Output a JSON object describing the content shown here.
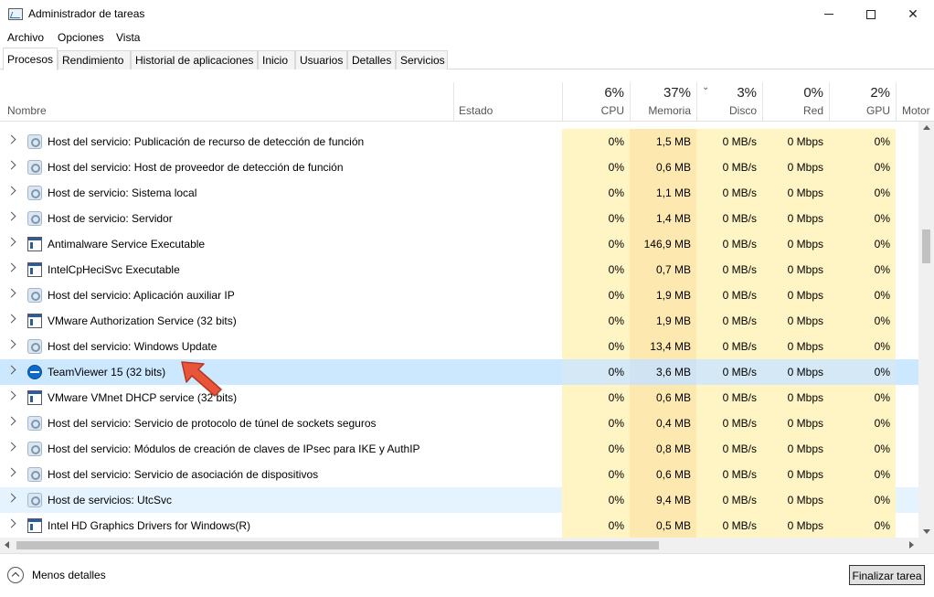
{
  "window": {
    "title": "Administrador de tareas",
    "controls": [
      "minimize",
      "maximize",
      "close"
    ]
  },
  "menu": [
    "Archivo",
    "Opciones",
    "Vista"
  ],
  "tabs": [
    {
      "label": "Procesos",
      "active": true
    },
    {
      "label": "Rendimiento",
      "active": false
    },
    {
      "label": "Historial de aplicaciones",
      "active": false
    },
    {
      "label": "Inicio",
      "active": false
    },
    {
      "label": "Usuarios",
      "active": false
    },
    {
      "label": "Detalles",
      "active": false
    },
    {
      "label": "Servicios",
      "active": false
    }
  ],
  "columns": {
    "name": "Nombre",
    "status": "Estado",
    "cpu": {
      "pct": "6%",
      "label": "CPU"
    },
    "memory": {
      "pct": "37%",
      "label": "Memoria"
    },
    "disk": {
      "pct": "3%",
      "label": "Disco"
    },
    "network": {
      "pct": "0%",
      "label": "Red"
    },
    "gpu": {
      "pct": "2%",
      "label": "GPU"
    },
    "engine": {
      "label": "Motor"
    }
  },
  "rows": [
    {
      "icon": "service-gear-icon",
      "name": "Host del servicio: Publicación de recurso de detección de función",
      "cpu": "0%",
      "mem": "1,5 MB",
      "disk": "0 MB/s",
      "net": "0 Mbps",
      "gpu": "0%"
    },
    {
      "icon": "service-gear-icon",
      "name": "Host del servicio: Host de proveedor de detección de función",
      "cpu": "0%",
      "mem": "0,6 MB",
      "disk": "0 MB/s",
      "net": "0 Mbps",
      "gpu": "0%"
    },
    {
      "icon": "service-gear-icon",
      "name": "Host de servicio: Sistema local",
      "cpu": "0%",
      "mem": "1,1 MB",
      "disk": "0 MB/s",
      "net": "0 Mbps",
      "gpu": "0%"
    },
    {
      "icon": "service-gear-icon",
      "name": "Host de servicio: Servidor",
      "cpu": "0%",
      "mem": "1,4 MB",
      "disk": "0 MB/s",
      "net": "0 Mbps",
      "gpu": "0%"
    },
    {
      "icon": "app-window-icon",
      "name": "Antimalware Service Executable",
      "cpu": "0%",
      "mem": "146,9 MB",
      "disk": "0 MB/s",
      "net": "0 Mbps",
      "gpu": "0%"
    },
    {
      "icon": "app-window-icon",
      "name": "IntelCpHeciSvc Executable",
      "cpu": "0%",
      "mem": "0,7 MB",
      "disk": "0 MB/s",
      "net": "0 Mbps",
      "gpu": "0%"
    },
    {
      "icon": "service-gear-icon",
      "name": "Host del servicio: Aplicación auxiliar IP",
      "cpu": "0%",
      "mem": "1,9 MB",
      "disk": "0 MB/s",
      "net": "0 Mbps",
      "gpu": "0%"
    },
    {
      "icon": "app-window-icon",
      "name": "VMware Authorization Service (32 bits)",
      "cpu": "0%",
      "mem": "1,9 MB",
      "disk": "0 MB/s",
      "net": "0 Mbps",
      "gpu": "0%"
    },
    {
      "icon": "service-gear-icon",
      "name": "Host del servicio: Windows Update",
      "cpu": "0%",
      "mem": "13,4 MB",
      "disk": "0 MB/s",
      "net": "0 Mbps",
      "gpu": "0%"
    },
    {
      "icon": "teamviewer-icon",
      "name": "TeamViewer 15 (32 bits)",
      "cpu": "0%",
      "mem": "3,6 MB",
      "disk": "0 MB/s",
      "net": "0 Mbps",
      "gpu": "0%",
      "state": "selected"
    },
    {
      "icon": "app-window-icon",
      "name": "VMware VMnet DHCP service (32 bits)",
      "cpu": "0%",
      "mem": "0,6 MB",
      "disk": "0 MB/s",
      "net": "0 Mbps",
      "gpu": "0%"
    },
    {
      "icon": "service-gear-icon",
      "name": "Host del servicio: Servicio de protocolo de túnel de sockets seguros",
      "cpu": "0%",
      "mem": "0,4 MB",
      "disk": "0 MB/s",
      "net": "0 Mbps",
      "gpu": "0%"
    },
    {
      "icon": "service-gear-icon",
      "name": "Host del servicio: Módulos de creación de claves de IPsec para IKE y AuthIP",
      "cpu": "0%",
      "mem": "0,8 MB",
      "disk": "0 MB/s",
      "net": "0 Mbps",
      "gpu": "0%"
    },
    {
      "icon": "service-gear-icon",
      "name": "Host del servicio: Servicio de asociación de dispositivos",
      "cpu": "0%",
      "mem": "0,6 MB",
      "disk": "0 MB/s",
      "net": "0 Mbps",
      "gpu": "0%"
    },
    {
      "icon": "service-gear-icon",
      "name": "Host de servicios: UtcSvc",
      "cpu": "0%",
      "mem": "9,4 MB",
      "disk": "0 MB/s",
      "net": "0 Mbps",
      "gpu": "0%",
      "state": "hover"
    },
    {
      "icon": "app-window-icon",
      "name": "Intel HD Graphics Drivers for Windows(R)",
      "cpu": "0%",
      "mem": "0,5 MB",
      "disk": "0 MB/s",
      "net": "0 Mbps",
      "gpu": "0%"
    }
  ],
  "footer": {
    "less_details": "Menos detalles",
    "end_task": "Finalizar tarea"
  },
  "colors": {
    "heat_light": "#fff4c4",
    "heat_mem": "#fde9b0",
    "selected": "#cce8ff",
    "hover": "#e5f3ff",
    "annotation_arrow": "#e8553a"
  }
}
